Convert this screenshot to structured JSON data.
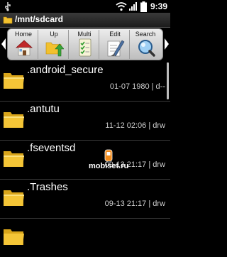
{
  "statusbar": {
    "time": "9:39"
  },
  "path": {
    "current": "/mnt/sdcard"
  },
  "toolbar": {
    "buttons": [
      {
        "label": "Home",
        "icon": "home-icon"
      },
      {
        "label": "Up",
        "icon": "folder-up-icon"
      },
      {
        "label": "Multi",
        "icon": "multi-select-icon"
      },
      {
        "label": "Edit",
        "icon": "edit-icon"
      },
      {
        "label": "Search",
        "icon": "search-icon"
      }
    ]
  },
  "files": [
    {
      "name": ".android_secure",
      "meta": "01-07  1980 | d--"
    },
    {
      "name": ".antutu",
      "meta": "11-12 02:06 | drw"
    },
    {
      "name": ".fseventsd",
      "meta": "09-13 21:17 | drw"
    },
    {
      "name": ".Trashes",
      "meta": "09-13 21:17 | drw"
    }
  ],
  "watermark": {
    "text": "mobiset.ru"
  },
  "colors": {
    "folder": "#f2c12e",
    "toolbar_bg": "#e0e0e0",
    "background": "#000000"
  }
}
